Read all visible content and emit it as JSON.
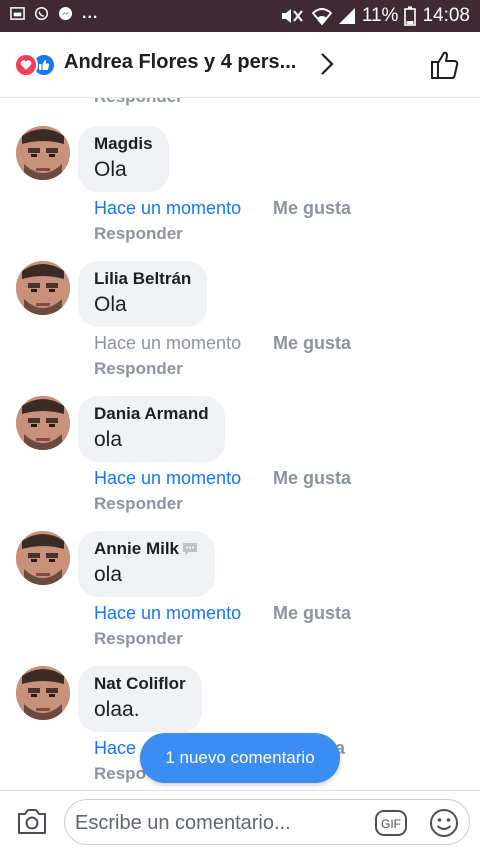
{
  "status_bar": {
    "battery": "11%",
    "time": "14:08",
    "overflow": "..."
  },
  "header": {
    "title": "Andrea Flores y 4 pers...",
    "accent": "#1877f2",
    "love_color": "#f33e58"
  },
  "comments_area": {
    "cut_reply": "Responder",
    "comments": [
      {
        "author": "Magdis",
        "text": "Ola",
        "time": "Hace un momento",
        "like": "Me gusta",
        "reply": "Responder"
      },
      {
        "author": "Lilia Beltrán",
        "text": "Ola",
        "time": "Hace un momento",
        "like": "Me gusta",
        "reply": "Responder"
      },
      {
        "author": "Dania Armand",
        "text": "ola",
        "time": "Hace un momento",
        "like": "Me gusta",
        "reply": "Responder"
      },
      {
        "author": "Annie Milk",
        "text": "ola",
        "time": "Hace un momento",
        "like": "Me gusta",
        "reply": "Responder"
      },
      {
        "author": "Nat Coliflor",
        "text": "olaa.",
        "time": "Hace",
        "like": "ta",
        "reply": "Respo"
      }
    ]
  },
  "new_comment_pill": "1 nuevo comentario",
  "composer": {
    "placeholder": "Escribe un comentario...",
    "gif_label": "GIF"
  }
}
